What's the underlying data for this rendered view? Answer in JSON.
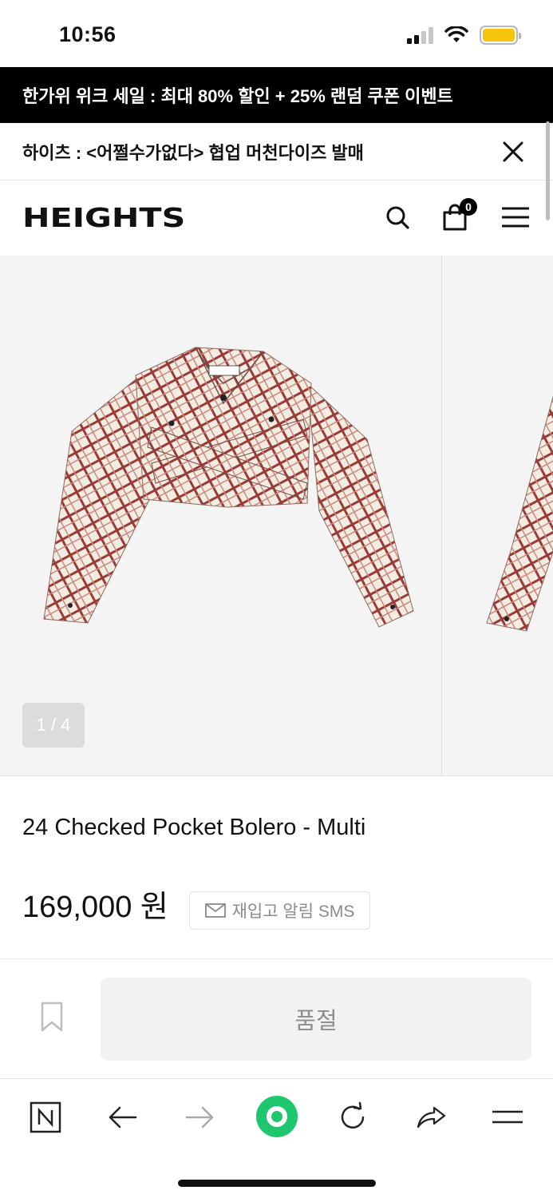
{
  "status_bar": {
    "time": "10:56"
  },
  "promo_banner": {
    "text": "한가위 위크 세일 : 최대 80% 할인 + 25% 랜덤 쿠폰 이벤트"
  },
  "notice": {
    "text": "하이츠 : <어쩔수가없다> 협업 머천다이즈 발매"
  },
  "header": {
    "logo": "HEIGHTS",
    "cart_count": "0"
  },
  "gallery": {
    "counter": "1 / 4"
  },
  "product": {
    "name": "24 Checked Pocket Bolero - Multi",
    "price": "169,000 원",
    "restock_label": "재입고 알림 SMS",
    "soldout_label": "품절"
  },
  "colors": {
    "promo_bg": "#000000",
    "accent_green": "#1ec76e",
    "battery": "#f5c40c"
  },
  "toolbar_icons": [
    "naver-n-icon",
    "back-arrow-icon",
    "forward-arrow-icon",
    "green-home-icon",
    "reload-icon",
    "share-icon",
    "menu-icon"
  ]
}
